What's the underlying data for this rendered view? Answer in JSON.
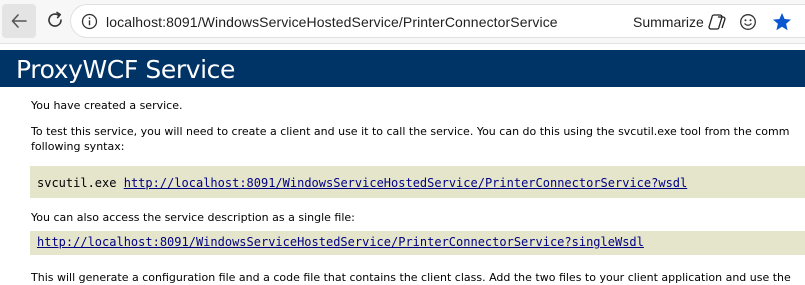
{
  "browser": {
    "url": "localhost:8091/WindowsServiceHostedService/PrinterConnectorService",
    "summarize_label": "Summarize",
    "accent": "#0b57d0",
    "icons": [
      "back-arrow-icon",
      "reload-icon",
      "info-icon",
      "copilot-icon",
      "emoji-icon",
      "favorite-star-icon"
    ]
  },
  "page": {
    "title": "ProxyWCF Service",
    "banner_color": "#003366",
    "code_background": "#e5e5cc",
    "link_color": "#000080",
    "intro": "You have created a service.",
    "test_instructions": "To test this service, you will need to create a client and use it to call the service. You can do this using the svcutil.exe tool from the comm",
    "test_instructions_2": "following syntax:",
    "command": "svcutil.exe",
    "wsdl_url": "http://localhost:8091/WindowsServiceHostedService/PrinterConnectorService?wsdl",
    "single_file_text": "You can also access the service description as a single file:",
    "single_wsdl_url": "http://localhost:8091/WindowsServiceHostedService/PrinterConnectorService?singleWsdl",
    "generate_text": "This will generate a configuration file and a code file that contains the client class. Add the two files to your client application and use the"
  }
}
